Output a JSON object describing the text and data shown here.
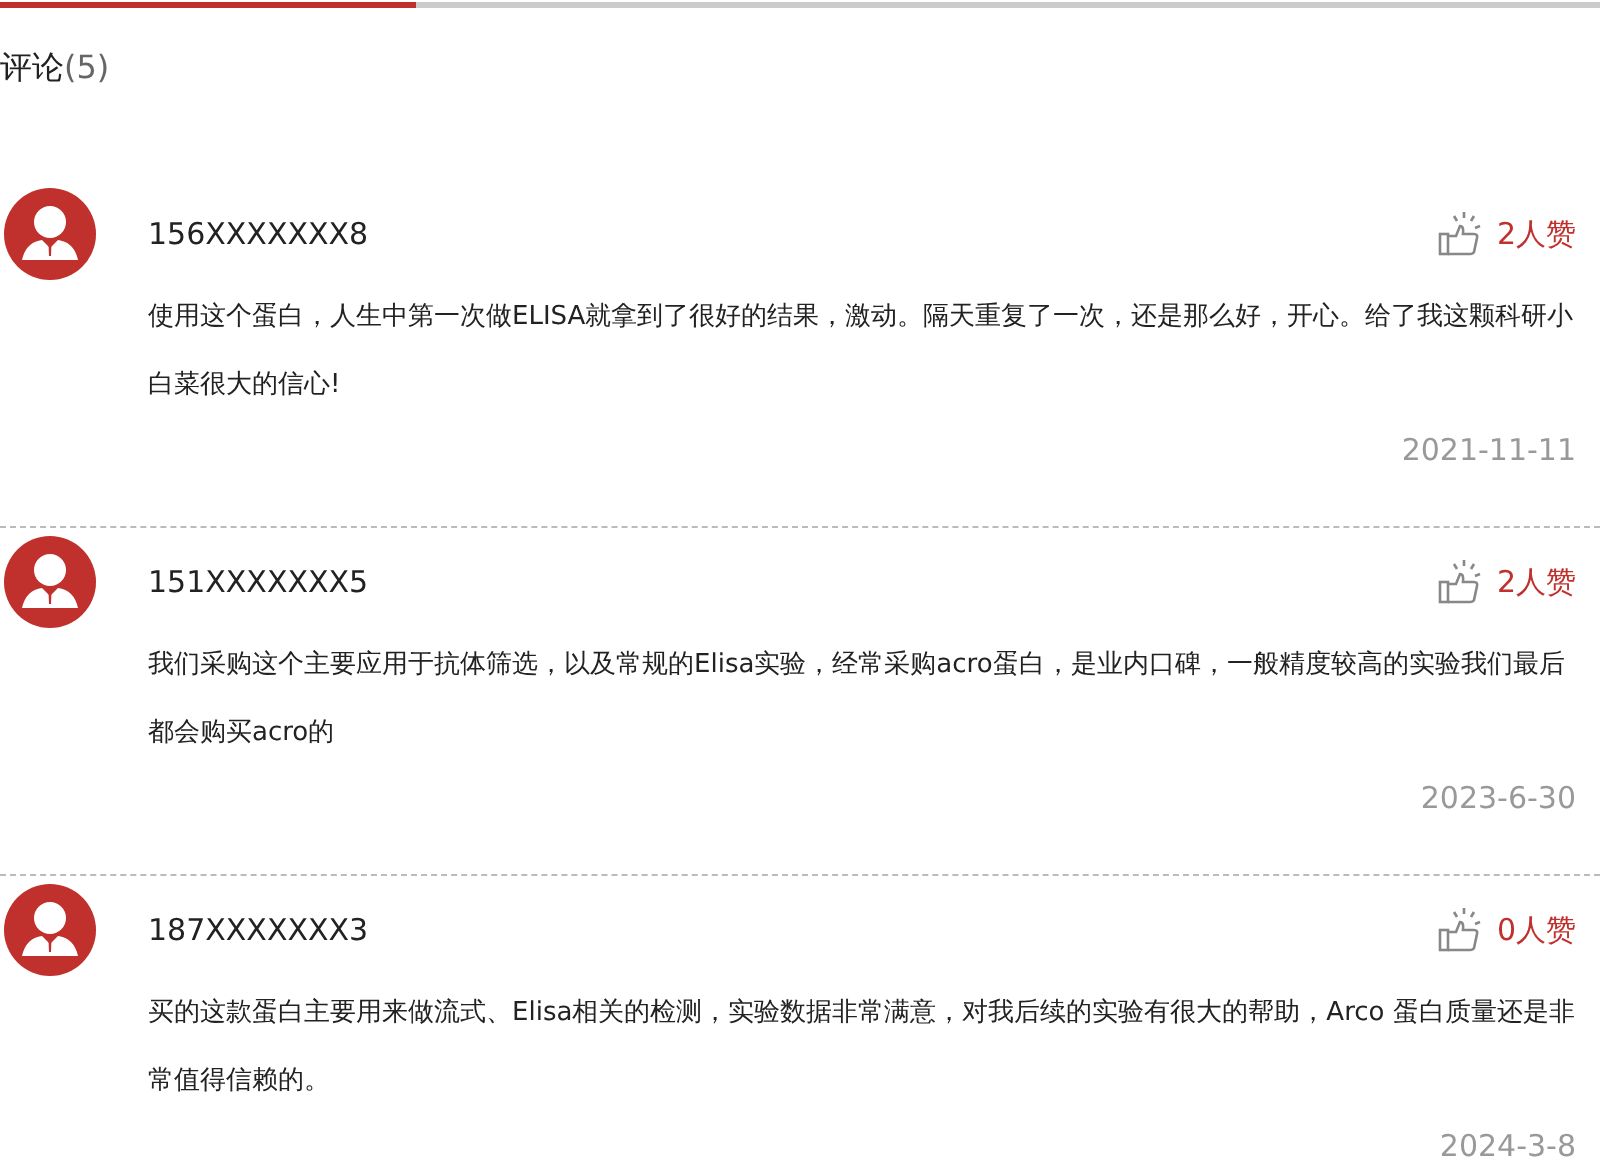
{
  "header": {
    "title": "评论",
    "count": "(5)"
  },
  "comments": [
    {
      "user": "156XXXXXXX8",
      "likes": "2人赞",
      "text": "使用这个蛋白，人生中第一次做ELISA就拿到了很好的结果，激动。隔天重复了一次，还是那么好，开心。给了我这颗科研小白菜很大的信心!",
      "date": "2021-11-11"
    },
    {
      "user": "151XXXXXXX5",
      "likes": "2人赞",
      "text": "我们采购这个主要应用于抗体筛选，以及常规的Elisa实验，经常采购acro蛋白，是业内口碑，一般精度较高的实验我们最后都会购买acro的",
      "date": "2023-6-30"
    },
    {
      "user": "187XXXXXXX3",
      "likes": "0人赞",
      "text": "买的这款蛋白主要用来做流式、Elisa相关的检测，实验数据非常满意，对我后续的实验有很大的帮助，Arco 蛋白质量还是非常值得信赖的。",
      "date": "2024-3-8"
    }
  ]
}
